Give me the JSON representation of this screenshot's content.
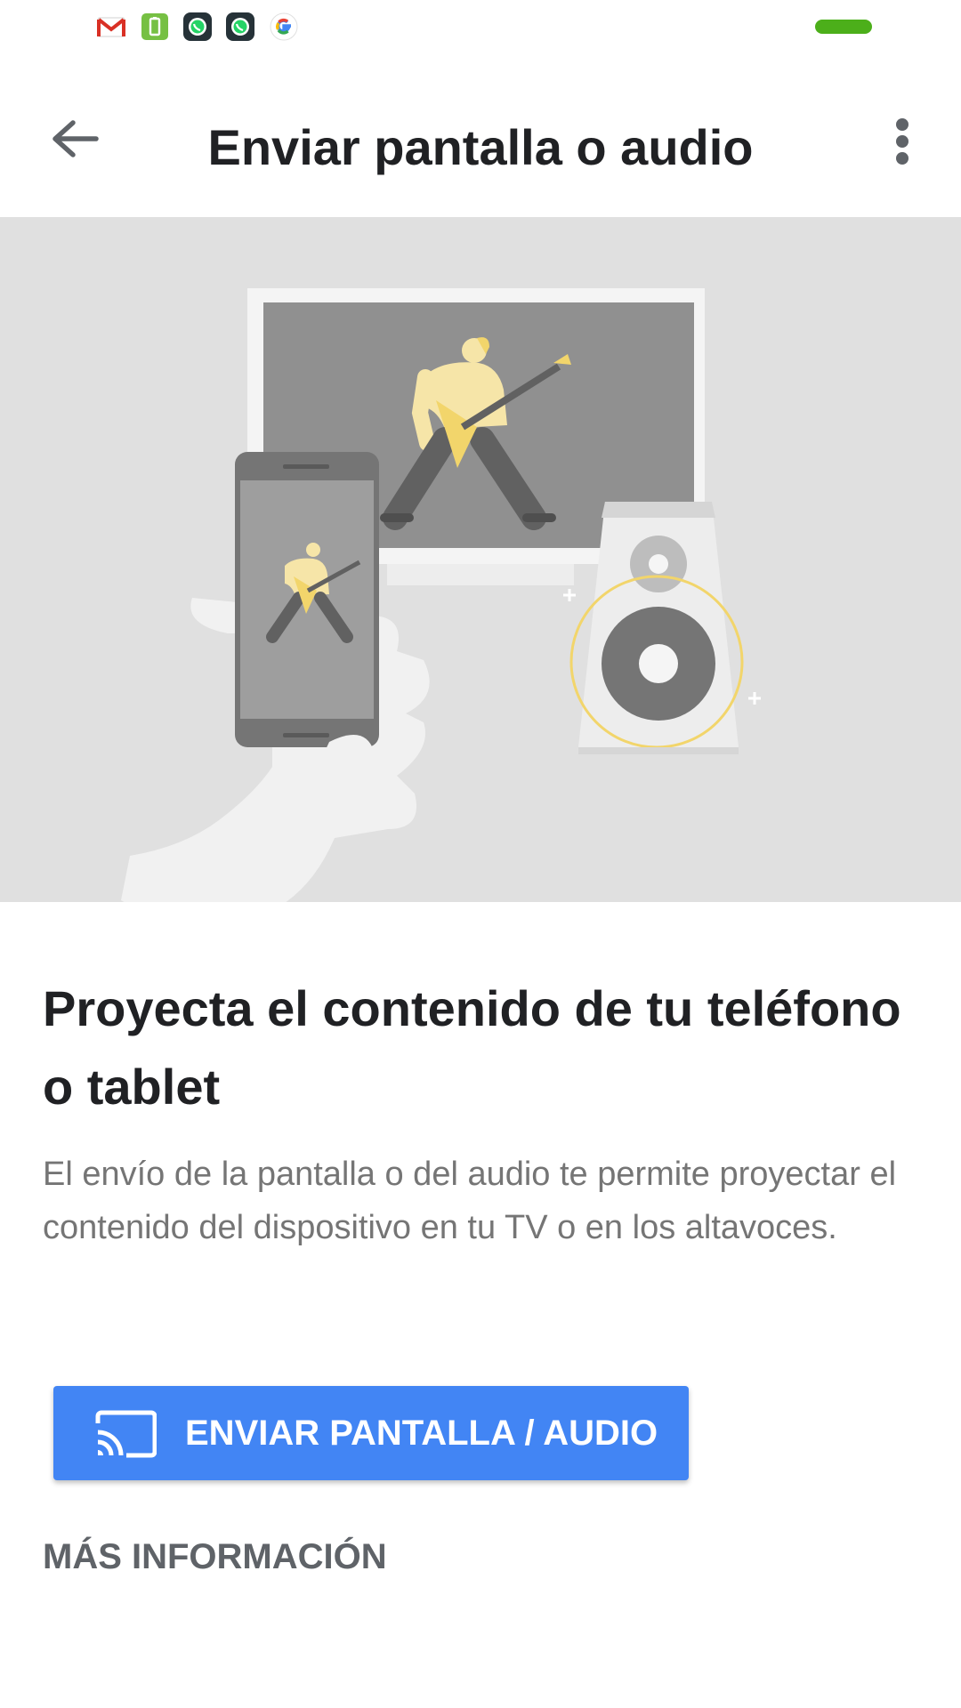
{
  "status_bar": {
    "notification_icons": [
      "gmail-icon",
      "battery-saver-icon",
      "whatsapp-icon",
      "whatsapp-icon",
      "google-icon"
    ],
    "colors": {
      "indicator": "#4caf1a"
    }
  },
  "app_bar": {
    "title": "Enviar pantalla o audio",
    "back_icon": "arrow-back-icon",
    "menu_icon": "more-vert-icon"
  },
  "hero": {
    "illustration": "phone-cast-to-tv-and-speaker"
  },
  "content": {
    "headline": "Proyecta el contenido de tu teléfono o tablet",
    "description": "El envío de la pantalla o del audio te permite proyectar el contenido del dispositivo en tu TV o en los altavoces."
  },
  "actions": {
    "cast_button_label": "ENVIAR PANTALLA / AUDIO",
    "cast_button_icon": "cast-icon",
    "more_info_label": "MÁS INFORMACIÓN"
  },
  "colors": {
    "primary": "#4285f4",
    "hero_background": "#e0e0e0",
    "accent_yellow": "#f2d56b"
  }
}
